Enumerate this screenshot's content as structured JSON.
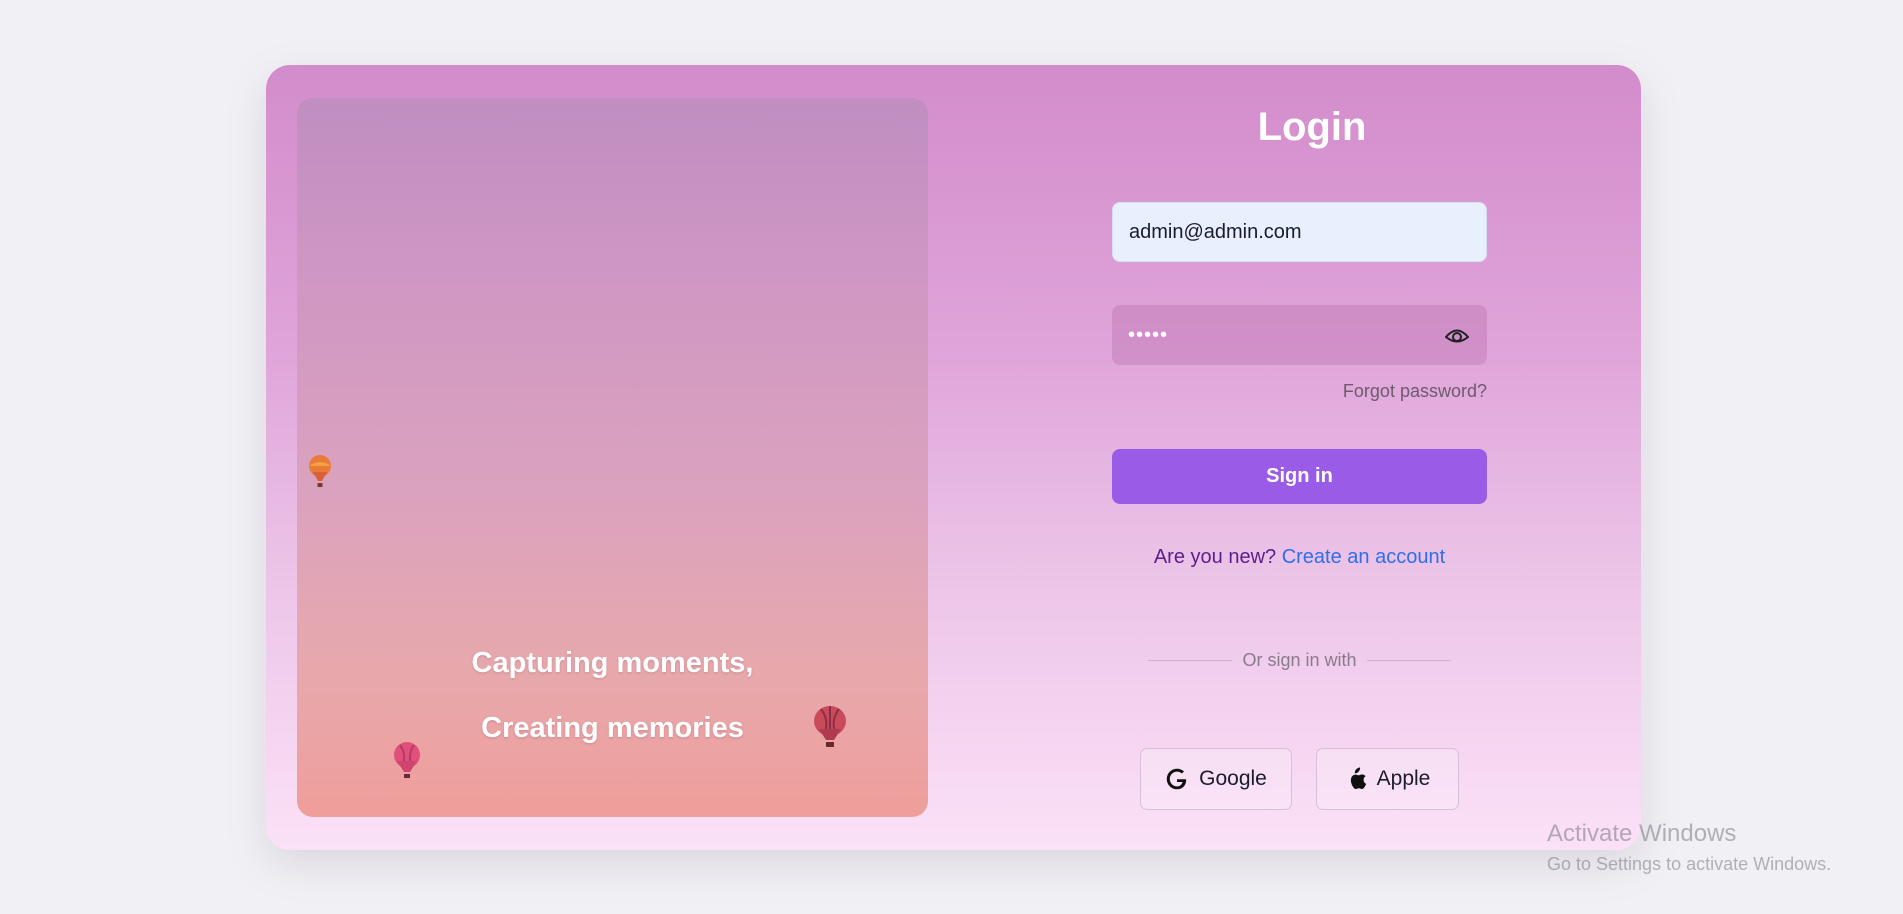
{
  "login": {
    "title": "Login",
    "email_value": "admin@admin.com",
    "password_value": "•••••",
    "forgot_password": "Forgot password?",
    "signin_label": "Sign in",
    "new_prompt": "Are you new?",
    "create_account": "Create an account",
    "divider_text": "Or sign in with",
    "google_label": "Google",
    "apple_label": "Apple"
  },
  "photo": {
    "tagline_line1": "Capturing moments,",
    "tagline_line2": "Creating memories"
  },
  "watermark": {
    "title": "Activate Windows",
    "subtitle": "Go to Settings to activate Windows."
  },
  "icons": {
    "password_toggle": "eye-icon",
    "google": "google-icon",
    "apple": "apple-icon",
    "balloons": "hot-air-balloon-icon"
  },
  "colors": {
    "accent": "#9a5be6",
    "link": "#2f6ee8",
    "prompt": "#5a1f8a"
  }
}
